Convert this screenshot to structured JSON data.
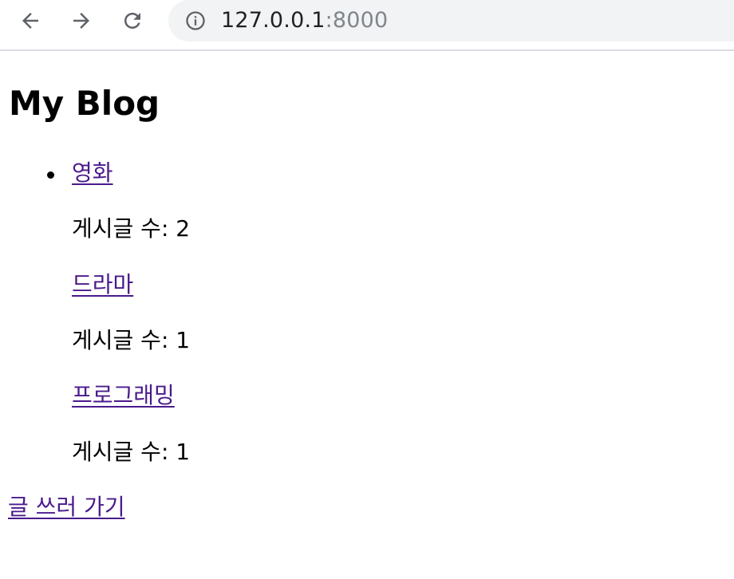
{
  "browser": {
    "url_host": "127.0.0.1",
    "url_port": ":8000",
    "icons": {
      "back": "back-arrow-icon",
      "forward": "forward-arrow-icon",
      "reload": "reload-icon",
      "info": "info-icon"
    }
  },
  "page": {
    "title": "My Blog",
    "categories": [
      {
        "name": "영화",
        "count_text": "게시글 수: 2"
      },
      {
        "name": "드라마",
        "count_text": "게시글 수: 1"
      },
      {
        "name": "프로그래밍",
        "count_text": "게시글 수: 1"
      }
    ],
    "write_link": "글 쓰러 가기"
  },
  "colors": {
    "link": "#4a1a8c",
    "toolbar_bg": "#ffffff",
    "omnibox_bg": "#f1f3f4",
    "port_text": "#80868b"
  }
}
